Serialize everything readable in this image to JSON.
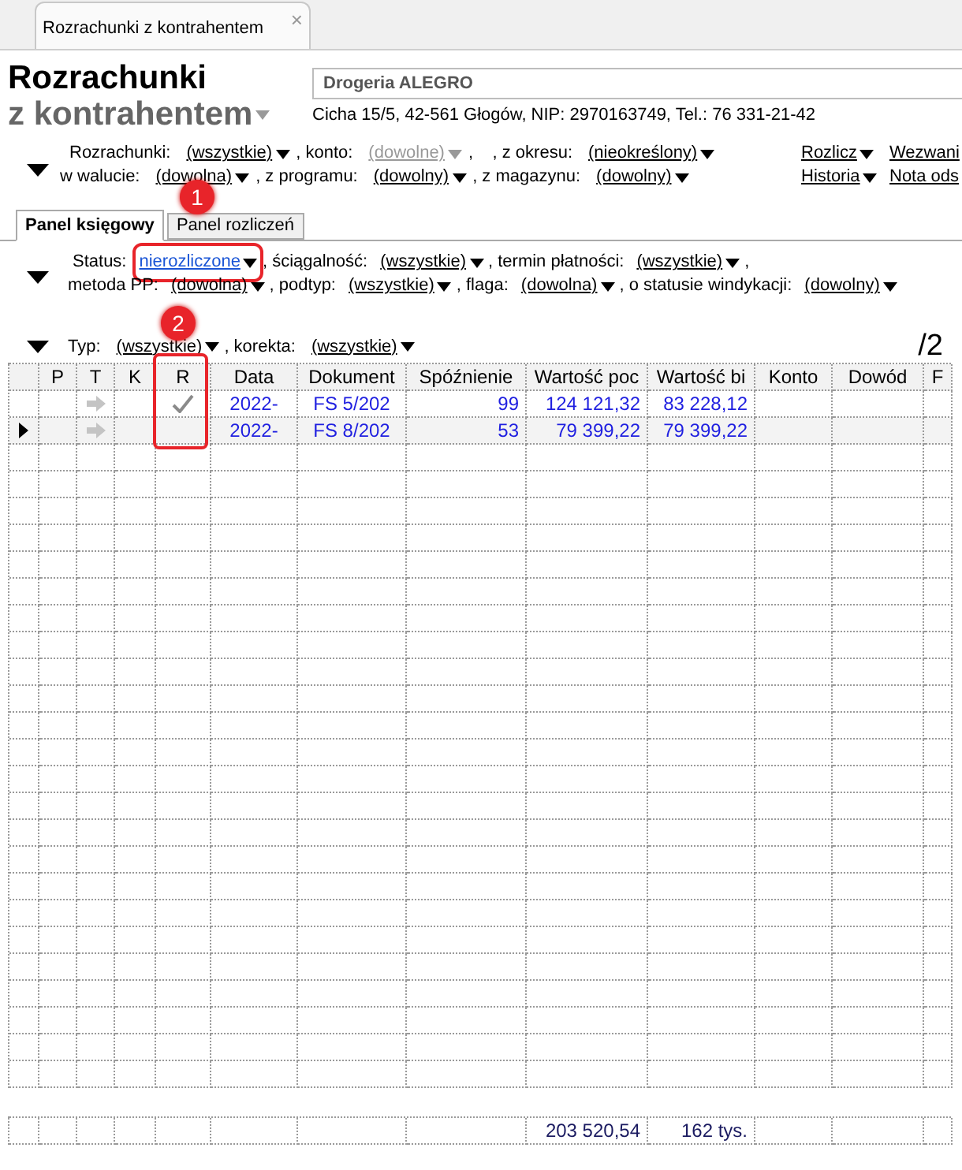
{
  "window_tab": {
    "title": "Rozrachunki z kontrahentem",
    "close": "×"
  },
  "header": {
    "title": "Rozrachunki",
    "subtitle": "z kontrahentem",
    "contractor": "Drogeria ALEGRO",
    "address": "Cicha  15/5, 42-561 Głogów, NIP: 2970163749, Tel.: 76 331-21-42"
  },
  "filters_top": [
    [
      {
        "label": "Rozrachunki:",
        "value": "(wszystkie)",
        "disabled": false
      },
      {
        "label": ", konto:",
        "value": "(dowolne)",
        "disabled": true
      },
      {
        "label": ",    , z okresu:",
        "value": "(nieokreślony)",
        "disabled": false
      }
    ],
    [
      {
        "label": "w walucie:",
        "value": "(dowolna)",
        "disabled": false
      },
      {
        "label": ", z programu:",
        "value": "(dowolny)",
        "disabled": false
      },
      {
        "label": ", z magazynu:",
        "value": "(dowolny)",
        "disabled": false
      }
    ]
  ],
  "actions": [
    {
      "label": "Rozlicz",
      "dropdown": true
    },
    {
      "label": "Wezwani"
    },
    {
      "label": "Historia",
      "dropdown": true
    },
    {
      "label": "Nota ods"
    }
  ],
  "tabs": [
    {
      "label": "Panel księgowy",
      "selected": true
    },
    {
      "label": "Panel rozliczeń",
      "selected": false
    }
  ],
  "filters_panel": [
    [
      {
        "label": "Status:",
        "value": "nierozliczone",
        "active": true,
        "annotation": "1"
      },
      {
        "label": ", ściągalność:",
        "value": "(wszystkie)",
        "active": false
      },
      {
        "label": ", termin płatności:",
        "value": "(wszystkie)",
        "active": false
      },
      {
        "label": ","
      }
    ],
    [
      {
        "label": "metoda PP:",
        "value": "(dowolna)",
        "active": false
      },
      {
        "label": ", podtyp:",
        "value": "(wszystkie)",
        "active": false
      },
      {
        "label": ", flaga:",
        "value": "(dowolna)",
        "active": false
      },
      {
        "label": ", o statusie windykacji:",
        "value": "(dowolny)",
        "active": false
      }
    ]
  ],
  "filters_type": [
    {
      "label": "Typ:",
      "value": "(wszystkie)"
    },
    {
      "label": ", korekta:",
      "value": "(wszystkie)"
    }
  ],
  "count": "/2",
  "table": {
    "columns": [
      "P",
      "T",
      "K",
      "R",
      "Data",
      "Dokument",
      "Spóźnienie",
      "Wartość poc",
      "Wartość bi",
      "Konto",
      "Dowód",
      "F"
    ],
    "annotated_column": "2",
    "rows": [
      {
        "selected": false,
        "settled": true,
        "date": "2022-",
        "document": "FS 5/202",
        "delay": "99",
        "initial_value": "124 121,32",
        "balance": "83 228,12"
      },
      {
        "selected": true,
        "settled": false,
        "date": "2022-",
        "document": "FS 8/202",
        "delay": "53",
        "initial_value": "79 399,22",
        "balance": "79 399,22"
      }
    ],
    "totals": {
      "initial_value": "203 520,54",
      "balance": "162 tys."
    }
  }
}
